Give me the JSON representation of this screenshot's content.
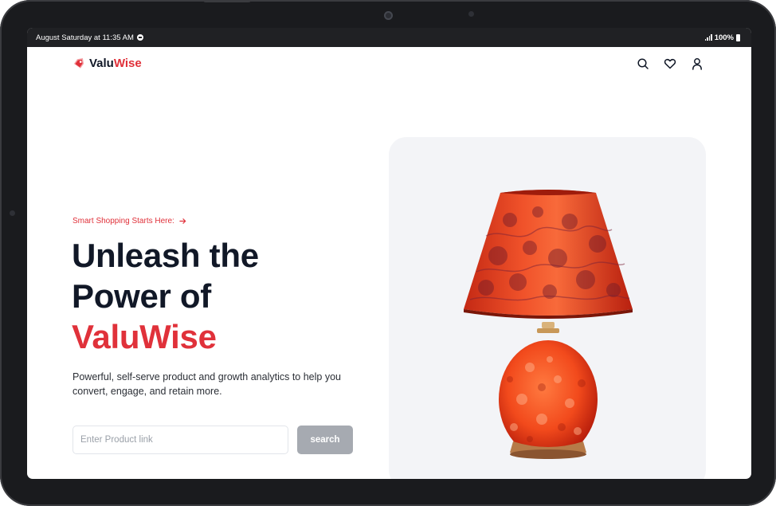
{
  "status_bar": {
    "datetime": "August Saturday at 11:35 AM",
    "battery": "100%"
  },
  "nav": {
    "brand_prefix": "Valu",
    "brand_suffix": "Wise",
    "icons": [
      "search-icon",
      "heart-icon",
      "user-icon"
    ]
  },
  "hero": {
    "eyebrow": "Smart Shopping Starts Here:",
    "headline_line1": "Unleash the",
    "headline_line2": "Power of",
    "headline_brand": "ValuWise",
    "description": "Powerful, self-serve product and growth analytics to help you convert, engage, and retain more."
  },
  "search": {
    "placeholder": "Enter Product link",
    "value": "",
    "button_label": "search"
  },
  "colors": {
    "accent": "#e0313a",
    "text_dark": "#111827",
    "button_gray": "#a6aab1",
    "card_bg": "#f3f4f7"
  }
}
